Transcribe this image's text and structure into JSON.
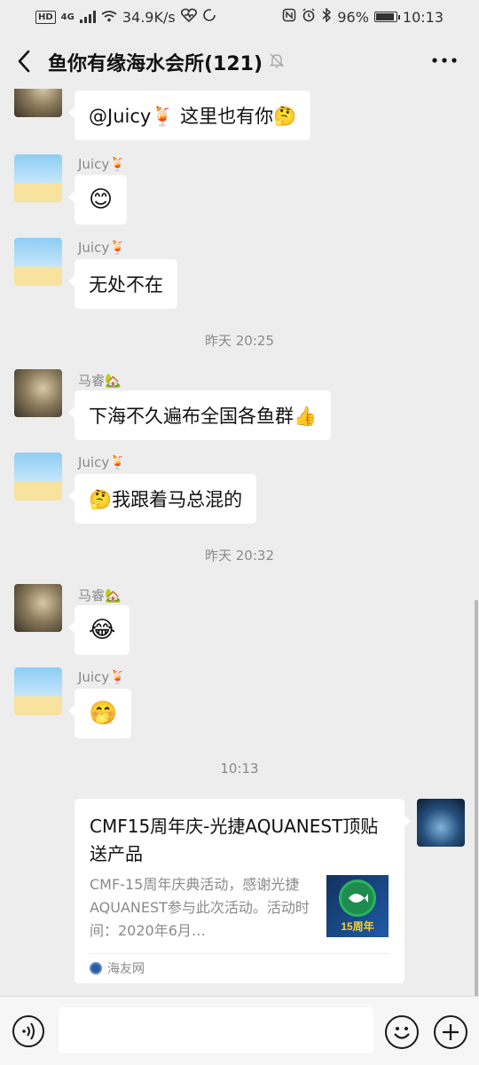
{
  "status_bar": {
    "hd": "HD",
    "network": "4G",
    "speed": "34.9K/s",
    "battery": "96%",
    "time": "10:13"
  },
  "header": {
    "title": "鱼你有缘海水会所(121)"
  },
  "messages": [
    {
      "text": "@Juicy🍹 这里也有你🤔"
    },
    {
      "nickname": "Juicy🍹",
      "text": "😊"
    },
    {
      "nickname": "Juicy🍹",
      "text": "无处不在"
    },
    {
      "nickname": "马睿🏡",
      "text": "下海不久遍布全国各鱼群👍"
    },
    {
      "nickname": "Juicy🍹",
      "text": "🤔我跟着马总混的"
    },
    {
      "nickname": "马睿🏡",
      "text": "😂"
    },
    {
      "nickname": "Juicy🍹",
      "text": "🤭"
    }
  ],
  "timestamps": [
    "昨天 20:25",
    "昨天 20:32",
    "10:13"
  ],
  "link_card": {
    "title": "CMF15周年庆-光捷AQUANEST顶贴送产品",
    "description": "CMF-15周年庆典活动，感谢光捷AQUANEST参与此次活动。活动时间：2020年6月…",
    "thumbnail_text": "15周年",
    "source": "海友网"
  },
  "input": {
    "value": "",
    "placeholder": ""
  },
  "colors": {
    "background": "#ededed",
    "bubble": "#ffffff",
    "timestamp": "#8a8a8a"
  }
}
